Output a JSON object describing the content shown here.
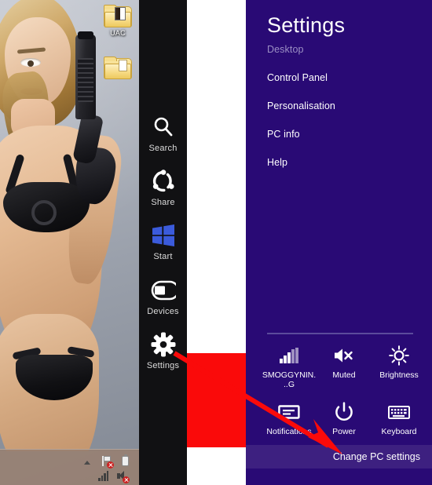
{
  "desktop": {
    "folders": [
      {
        "label": "UAC",
        "icon": "folder-open-icon"
      },
      {
        "label": "",
        "icon": "folder-icon"
      }
    ],
    "taskbar": {
      "tray_icons_row1": [
        {
          "name": "show-hidden-icons-chevron",
          "label": "Show hidden icons"
        },
        {
          "name": "action-center-flag-icon",
          "label": "Action Center"
        },
        {
          "name": "battery-icon",
          "label": "Battery"
        }
      ],
      "tray_icons_row2": [
        {
          "name": "network-signal-icon",
          "label": "Network"
        },
        {
          "name": "volume-muted-icon",
          "label": "Volume muted"
        }
      ]
    }
  },
  "charms": {
    "items": [
      {
        "label": "Search",
        "icon": "search-icon"
      },
      {
        "label": "Share",
        "icon": "share-icon"
      },
      {
        "label": "Start",
        "icon": "windows-start-icon"
      },
      {
        "label": "Devices",
        "icon": "devices-icon"
      },
      {
        "label": "Settings",
        "icon": "gear-icon"
      }
    ]
  },
  "settings_panel": {
    "title": "Settings",
    "context_label": "Desktop",
    "menu_items": [
      "Control Panel",
      "Personalisation",
      "PC info",
      "Help"
    ],
    "quick_settings": [
      {
        "label": "SMOGGYNIN...G",
        "icon": "network-signal-icon"
      },
      {
        "label": "Muted",
        "icon": "speaker-muted-icon"
      },
      {
        "label": "Brightness",
        "icon": "brightness-sun-icon"
      },
      {
        "label": "Notifications",
        "icon": "notifications-icon"
      },
      {
        "label": "Power",
        "icon": "power-icon"
      },
      {
        "label": "Keyboard",
        "icon": "keyboard-icon"
      }
    ],
    "change_pc_settings": "Change PC settings"
  },
  "annotations": {
    "highlight_rect_color": "#fa0a0a",
    "arrow_color": "#fa0a0a"
  },
  "colors": {
    "panel_bg": "#290a75",
    "highlight_row_bg": "#3d2080",
    "charms_bg": "#111113",
    "accent_red": "#fa0a0a"
  }
}
